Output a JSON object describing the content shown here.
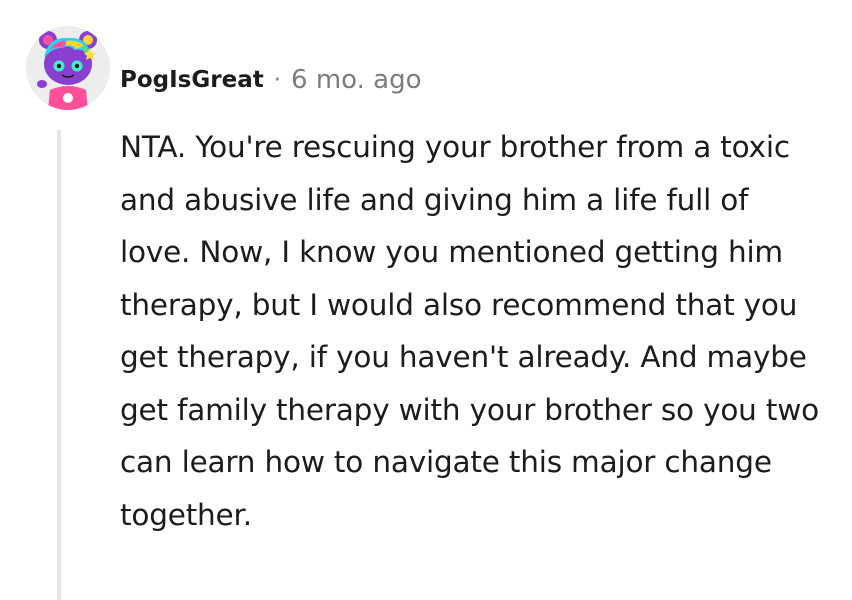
{
  "comment": {
    "username": "PogIsGreat",
    "separator": "·",
    "timestamp": "6 mo. ago",
    "avatar_icon": "snoo-avatar-icon",
    "body": "NTA. You're rescuing your brother from a toxic and abusive life and giving him a life full of love. Now, I know you mentioned getting him therapy, but I would also recommend that you get therapy, if you haven't already. And maybe get family therapy with your brother so you two can learn how to navigate this major change together."
  },
  "colors": {
    "text": "#1c1c1c",
    "meta": "#7c7c7c",
    "thread_line": "#e5e5e5",
    "avatar_bg": "#ededed"
  }
}
